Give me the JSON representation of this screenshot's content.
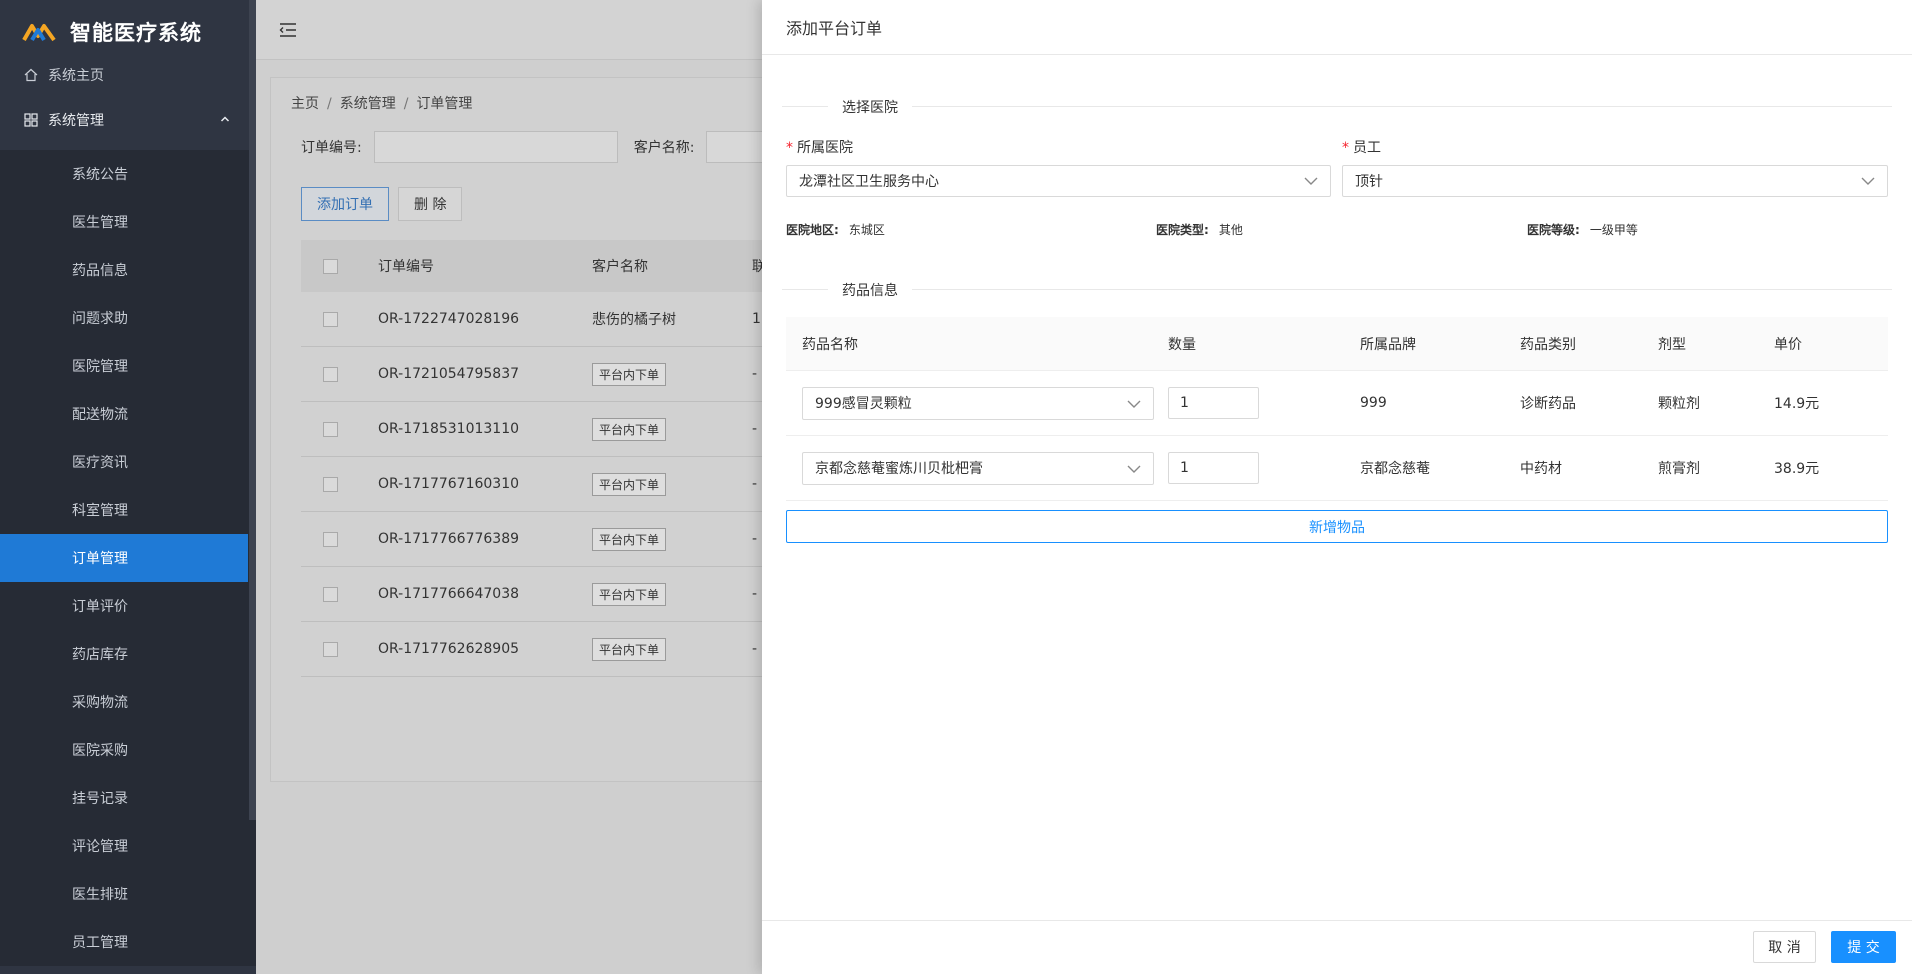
{
  "app": {
    "title": "智能医疗系统",
    "logo": "logo-icon"
  },
  "sidebar": {
    "home": {
      "label": "系统主页",
      "icon": "home-icon"
    },
    "group": {
      "label": "系统管理",
      "icon": "grid-icon"
    },
    "items": [
      {
        "label": "系统公告"
      },
      {
        "label": "医生管理"
      },
      {
        "label": "药品信息"
      },
      {
        "label": "问题求助"
      },
      {
        "label": "医院管理"
      },
      {
        "label": "配送物流"
      },
      {
        "label": "医疗资讯"
      },
      {
        "label": "科室管理"
      },
      {
        "label": "订单管理",
        "active": true
      },
      {
        "label": "订单评价"
      },
      {
        "label": "药店库存"
      },
      {
        "label": "采购物流"
      },
      {
        "label": "医院采购"
      },
      {
        "label": "挂号记录"
      },
      {
        "label": "评论管理"
      },
      {
        "label": "医生排班"
      },
      {
        "label": "员工管理"
      }
    ],
    "accent": "#1f7ad6"
  },
  "main": {
    "breadcrumb": [
      "主页",
      "系统管理",
      "订单管理"
    ],
    "search": {
      "order_code_label": "订单编号:",
      "customer_label": "客户名称:"
    },
    "buttons": {
      "add": "添加订单",
      "delete": "删 除"
    },
    "table": {
      "headers": [
        "订单编号",
        "客户名称",
        "联"
      ],
      "rows": [
        {
          "code": "OR-1722747028196",
          "customer": "悲伤的橘子树",
          "extra": "1"
        },
        {
          "code": "OR-1721054795837",
          "customer": "平台内下单",
          "extra": "-"
        },
        {
          "code": "OR-1718531013110",
          "customer": "平台内下单",
          "extra": "-"
        },
        {
          "code": "OR-1717767160310",
          "customer": "平台内下单",
          "extra": "-"
        },
        {
          "code": "OR-1717766776389",
          "customer": "平台内下单",
          "extra": "-"
        },
        {
          "code": "OR-1717766647038",
          "customer": "平台内下单",
          "extra": "-"
        },
        {
          "code": "OR-1717762628905",
          "customer": "平台内下单",
          "extra": "-"
        }
      ]
    }
  },
  "drawer": {
    "title": "添加平台订单",
    "section_hospital": "选择医院",
    "hospital_label": "所属医院",
    "hospital_value": "龙潭社区卫生服务中心",
    "staff_label": "员工",
    "staff_value": "顶针",
    "info": {
      "region_label": "医院地区:",
      "region_value": "东城区",
      "type_label": "医院类型:",
      "type_value": "其他",
      "level_label": "医院等级:",
      "level_value": "一级甲等"
    },
    "section_medicine": "药品信息",
    "med_headers": [
      "药品名称",
      "数量",
      "所属品牌",
      "药品类别",
      "剂型",
      "单价"
    ],
    "medicines": [
      {
        "name": "999感冒灵颗粒",
        "qty": "1",
        "brand": "999",
        "category": "诊断药品",
        "form": "颗粒剂",
        "price": "14.9元"
      },
      {
        "name": "京都念慈菴蜜炼川贝枇杷膏",
        "qty": "1",
        "brand": "京都念慈菴",
        "category": "中药材",
        "form": "煎膏剂",
        "price": "38.9元"
      }
    ],
    "add_item": "新增物品",
    "cancel": "取 消",
    "submit": "提 交",
    "primary_color": "#1890ff"
  }
}
